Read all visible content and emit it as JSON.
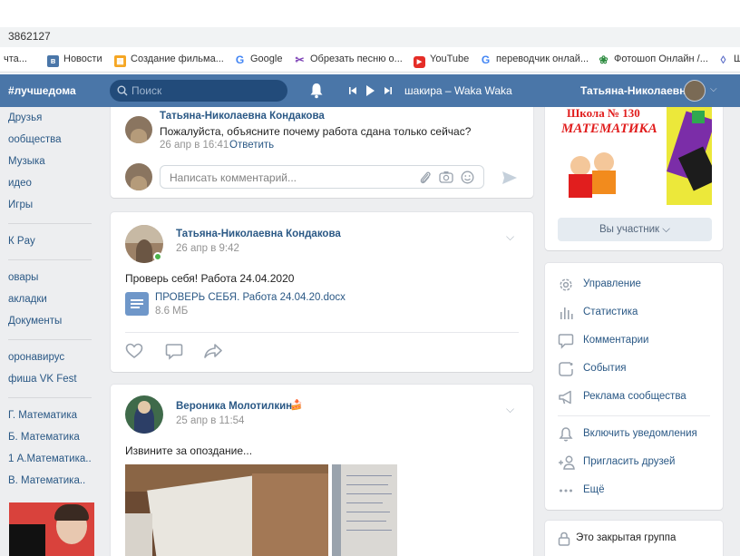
{
  "browser": {
    "url_fragment": "3862127",
    "bookmarks": [
      {
        "label": "чта...",
        "icon": "mail-icon"
      },
      {
        "label": "Новости",
        "icon": "vk-icon"
      },
      {
        "label": "Создание фильма...",
        "icon": "film-app-icon"
      },
      {
        "label": "Google",
        "icon": "google-icon"
      },
      {
        "label": "Обрезать песню о...",
        "icon": "scissors-icon"
      },
      {
        "label": "YouTube",
        "icon": "youtube-icon"
      },
      {
        "label": "переводчик онлай...",
        "icon": "google-icon"
      },
      {
        "label": "Фотошоп Онлайн /...",
        "icon": "photoshop-online-icon"
      },
      {
        "label": "Ш",
        "icon": "shield-icon"
      }
    ]
  },
  "header": {
    "hashtag": "#лучшедома",
    "search_placeholder": "Поиск",
    "now_playing": "шакира – Waka Waka",
    "user_name": "Татьяна-Николаевна"
  },
  "left_menu": {
    "group1": [
      "Друзья",
      "Сообщества",
      "Музыка",
      "Видео",
      "Игры"
    ],
    "group2": [
      "VK Pay"
    ],
    "group3": [
      "Товары",
      "Закладки",
      "Документы"
    ],
    "group4": [
      "Коронавирус",
      "Афиша VK Fest"
    ],
    "group5": [
      "Г. Математика",
      "Б. Математика",
      "1 А.Математика..",
      "В. Математика.."
    ]
  },
  "left_menu_display": {
    "group1": [
      "Друзья",
      "ообщества",
      "Музыка",
      "идео",
      "Игры"
    ],
    "group2": [
      "К Pay"
    ],
    "group3": [
      "овары",
      "акладки",
      "Документы"
    ],
    "group4": [
      "оронавирус",
      "фиша VK Fest"
    ],
    "group5": [
      "Г. Математика",
      "Б. Математика",
      "1 А.Математика..",
      "В. Математика.."
    ]
  },
  "comment": {
    "author": "Татьяна-Николаевна Кондакова",
    "text": "Пожалуйста, объясните почему работа сдана только сейчас?",
    "time": "26 апр в 16:41",
    "reply_label": "Ответить",
    "input_placeholder": "Написать комментарий..."
  },
  "post1": {
    "author": "Татьяна-Николаевна Кондакова",
    "time": "26 апр в 9:42",
    "text": "Проверь себя! Работа 24.04.2020",
    "doc_name": "ПРОВЕРЬ СЕБЯ. Работа 24.04.20.docx",
    "doc_size": "8.6 МБ"
  },
  "post2": {
    "author": "Вероника Молотилкина",
    "author_emoji": "🍰",
    "time": "25 апр в 11:54",
    "text": "Извините за опоздание..."
  },
  "community": {
    "banner_line1": "Школа № 130",
    "banner_line2": "МАТЕМАТИКА",
    "member_button": "Вы участник",
    "menu": [
      "Управление",
      "Статистика",
      "Комментарии",
      "События",
      "Реклама сообщества"
    ],
    "menu2": [
      "Включить уведомления",
      "Пригласить друзей",
      "Ещё"
    ],
    "bottom_partial": "Это закрытая группа"
  },
  "colors": {
    "vk_blue": "#4a76a8",
    "link": "#2a5885",
    "page_bg": "#edeef0",
    "banner_red": "#e11e1e"
  }
}
